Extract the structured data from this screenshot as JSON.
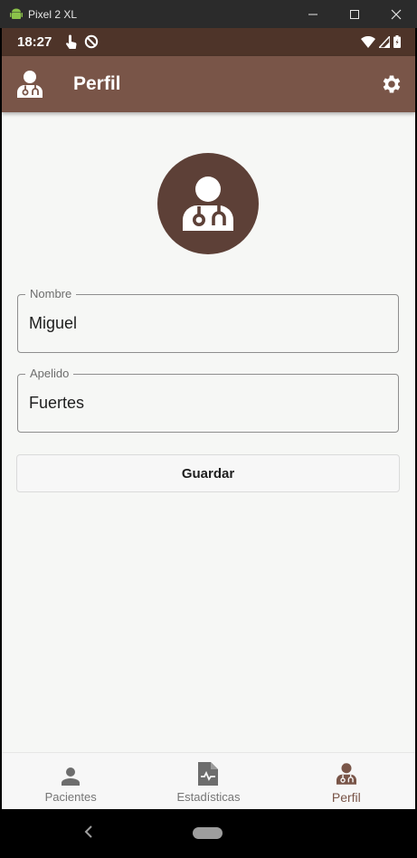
{
  "window": {
    "title": "Pixel 2 XL"
  },
  "statusbar": {
    "time": "18:27"
  },
  "appbar": {
    "title": "Perfil"
  },
  "form": {
    "nombre": {
      "label": "Nombre",
      "value": "Miguel"
    },
    "apellido": {
      "label": "Apelido",
      "value": "Fuertes"
    },
    "save_label": "Guardar"
  },
  "bottom_nav": {
    "items": [
      {
        "label": "Pacientes",
        "icon": "person-icon",
        "active": false
      },
      {
        "label": "Estadísticas",
        "icon": "file-chart-icon",
        "active": false
      },
      {
        "label": "Perfil",
        "icon": "doctor-icon",
        "active": true
      }
    ]
  },
  "colors": {
    "primary": "#795548",
    "primary_dark": "#4e3429",
    "avatar_bg": "#5d4037",
    "background": "#f6f7f5"
  }
}
